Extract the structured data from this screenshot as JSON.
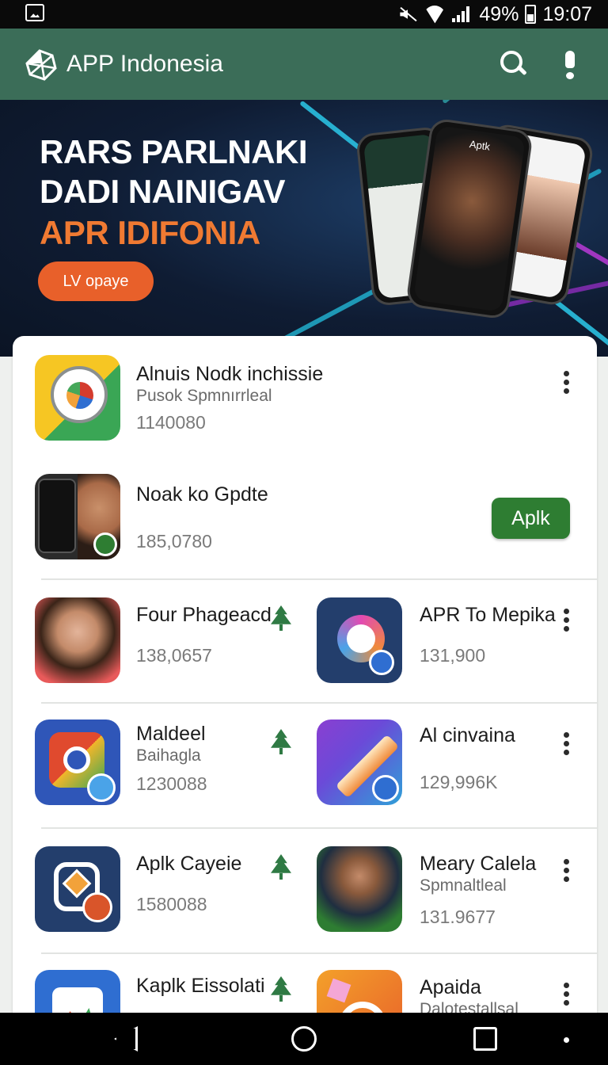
{
  "status_bar": {
    "battery": "49%",
    "time": "19:07"
  },
  "app_bar": {
    "title": "APP Indonesia"
  },
  "banner": {
    "line1": "RARS PARLNAKI",
    "line2": "DADI NAINIGAV",
    "line3": "APR IDIFONIA",
    "button": "LV opaye",
    "colors": {
      "line1": "#ffffff",
      "line2": "#ffffff",
      "line3": "#f07a32",
      "button": "#e8602a"
    },
    "phone_label": "Aptk"
  },
  "apps": {
    "featured1": {
      "name": "Alnuis Nodk inchissie",
      "subtitle": "Pusok Spmnırrleal",
      "count": "1140080"
    },
    "featured2": {
      "name": "Noak ko Gpdte",
      "count": "185,0780",
      "button": "Aplk"
    },
    "r1_left": {
      "name": "Four Phageacd",
      "count": "138,0657"
    },
    "r1_right": {
      "name": "APR To Mepika",
      "count": "131,900"
    },
    "r2_left": {
      "name": "Maldeel",
      "subtitle": "Baihagla",
      "count": "1230088"
    },
    "r2_right": {
      "name": "Al cinvaina",
      "count": "129,996K"
    },
    "r3_left": {
      "name": "Aplk Cayeie",
      "count": "1580088"
    },
    "r3_right": {
      "name": "Meary Calela",
      "subtitle": "Spmnaltleal",
      "count": "131.9677"
    },
    "r4_left": {
      "name": "Kaplk Eissolati"
    },
    "r4_right": {
      "name": "Apaida",
      "subtitle": "Dalotestallsal"
    }
  },
  "colors": {
    "app_bar": "#3b6d58",
    "accent_green": "#2e7d32",
    "banner_orange": "#e8602a"
  },
  "icons": [
    "image-icon",
    "mute-icon",
    "wifi-icon",
    "signal-icon",
    "battery-icon",
    "logo-icon",
    "search-icon",
    "alert-icon",
    "more-vert-icon",
    "tree-icon",
    "back-icon",
    "home-icon",
    "recents-icon"
  ]
}
